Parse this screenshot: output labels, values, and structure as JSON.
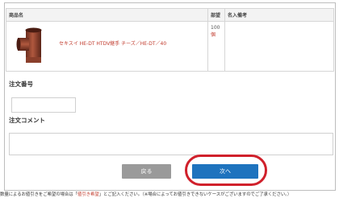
{
  "table": {
    "headers": [
      "商品名",
      "部望",
      "名入備考"
    ],
    "product": {
      "name": "セキスイ HE-DT HTDV継手 チーズ／HE-DT／40",
      "qty": "100",
      "unit": "個",
      "image_icon": "pipe-tee-fitting-icon"
    }
  },
  "order_number": {
    "label": "注文番号",
    "value": ""
  },
  "order_comment": {
    "label": "注文コメント",
    "value": ""
  },
  "buttons": {
    "back_label": "戻る",
    "next_label": "次へ"
  },
  "note": {
    "prefix": "数量によるお値引きをご希望の場合は「",
    "keyword": "値引き希望",
    "suffix": "」とご記入ください。（※場合によってお値引きできないケースがございますのでご了承ください。）"
  },
  "colors": {
    "accent_blue": "#1e73be",
    "back_gray": "#9a9a9a",
    "highlight_red": "#d0202b",
    "product_red": "#c0392b"
  }
}
